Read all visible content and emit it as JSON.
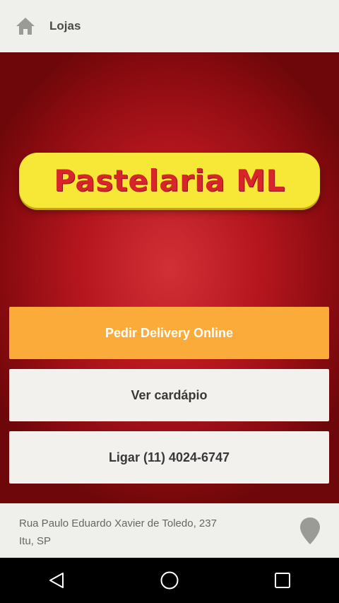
{
  "app_bar": {
    "title": "Lojas",
    "home_icon": "home-icon"
  },
  "hero": {
    "logo_text": "Pastelaria ML"
  },
  "actions": {
    "delivery_label": "Pedir Delivery Online",
    "menu_label": "Ver cardápio",
    "call_label": "Ligar (11) 4024-6747"
  },
  "footer": {
    "address_line1": "Rua Paulo Eduardo Xavier de Toledo, 237",
    "address_line2": "Itu, SP",
    "map_icon": "map-pin-icon"
  },
  "nav": {
    "back_icon": "back-icon",
    "home_icon": "home-circle-icon",
    "recents_icon": "recents-icon"
  },
  "colors": {
    "delivery_button": "#fbab3a",
    "hero_red": "#b5161e",
    "logo_yellow": "#f7e838",
    "logo_text_red": "#d7262b"
  }
}
